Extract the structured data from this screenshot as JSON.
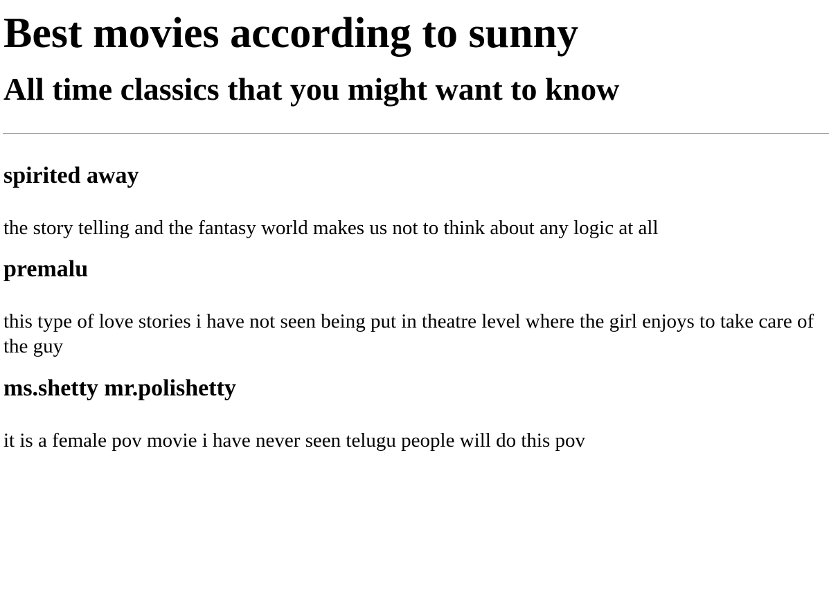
{
  "page": {
    "title": "Best movies according to sunny",
    "subtitle": "All time classics that you might want to know"
  },
  "movies": [
    {
      "title": "spirited away",
      "description": "the story telling and the fantasy world makes us not to think about any logic at all"
    },
    {
      "title": "premalu",
      "description": "this type of love stories i have not seen being put in theatre level where the girl enjoys to take care of the guy"
    },
    {
      "title": "ms.shetty mr.polishetty",
      "description": "it is a female pov movie i have never seen telugu people will do this pov"
    }
  ],
  "colors": {
    "text": "#000000",
    "background": "#ffffff",
    "divider": "#9a9a9a"
  }
}
